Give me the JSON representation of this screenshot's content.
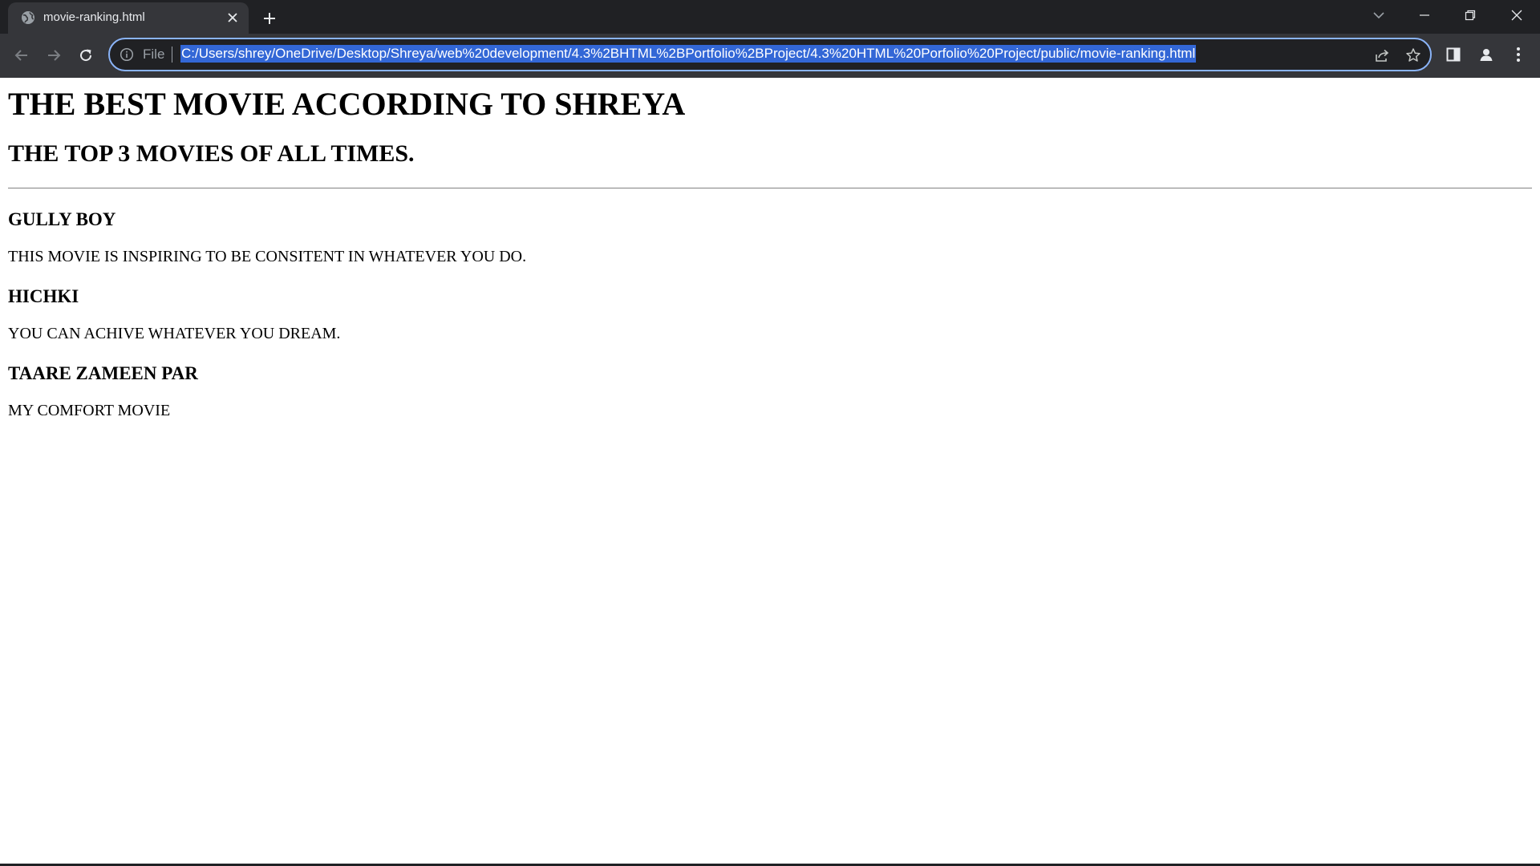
{
  "browser": {
    "tab": {
      "title": "movie-ranking.html",
      "favicon": "globe-icon"
    },
    "omnibox": {
      "scheme_label": "File",
      "url": "C:/Users/shrey/OneDrive/Desktop/Shreya/web%20development/4.3%2BHTML%2BPortfolio%2BProject/4.3%20HTML%20Porfolio%20Project/public/movie-ranking.html"
    },
    "colors": {
      "tabstrip_bg": "#202124",
      "toolbar_bg": "#35363a",
      "omnibox_border": "#8ab4f8",
      "url_selection": "#3367d6"
    }
  },
  "page": {
    "heading": "THE BEST MOVIE ACCORDING TO SHREYA",
    "subheading": "THE TOP 3 MOVIES OF ALL TIMES.",
    "movies": [
      {
        "title": "GULLY BOY",
        "description": "THIS MOVIE IS INSPIRING TO BE CONSITENT IN WHATEVER YOU DO."
      },
      {
        "title": "HICHKI",
        "description": "YOU CAN ACHIVE WHATEVER YOU DREAM."
      },
      {
        "title": "TAARE ZAMEEN PAR",
        "description": "MY COMFORT MOVIE"
      }
    ]
  }
}
